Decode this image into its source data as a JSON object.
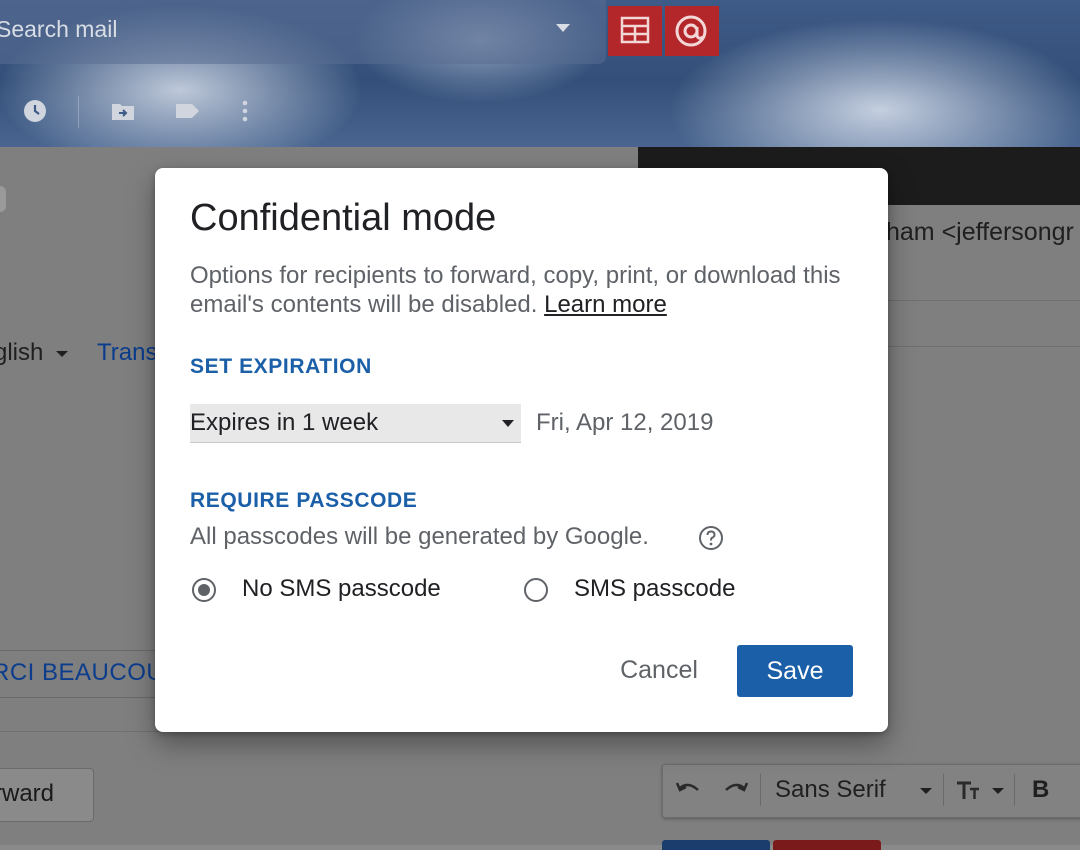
{
  "app": {
    "search": {
      "placeholder": "Search mail"
    },
    "left_pane": {
      "language": "glish",
      "translate_link": "Trans",
      "recipient_chip": "RCI BEAUCOU",
      "forward_button": "rward"
    },
    "compose": {
      "to_text": "ham <jeffersongr",
      "format_bar": {
        "font_name": "Sans Serif",
        "bold_label": "B"
      }
    },
    "colors": {
      "addon_red": "#b3262a",
      "brand_blue": "#1a5fa8"
    }
  },
  "dialog": {
    "title": "Confidential mode",
    "description": "Options for recipients to forward, copy, print, or download this email's contents will be disabled.",
    "learn_more": "Learn more",
    "set_expiration_label": "SET EXPIRATION",
    "expiration_select_value": "Expires in 1 week",
    "expiration_date": "Fri, Apr 12, 2019",
    "require_passcode_label": "REQUIRE PASSCODE",
    "passcode_hint": "All passcodes will be generated by Google.",
    "radio_options": [
      {
        "label": "No SMS passcode",
        "selected": true
      },
      {
        "label": "SMS passcode",
        "selected": false
      }
    ],
    "cancel_label": "Cancel",
    "save_label": "Save"
  }
}
